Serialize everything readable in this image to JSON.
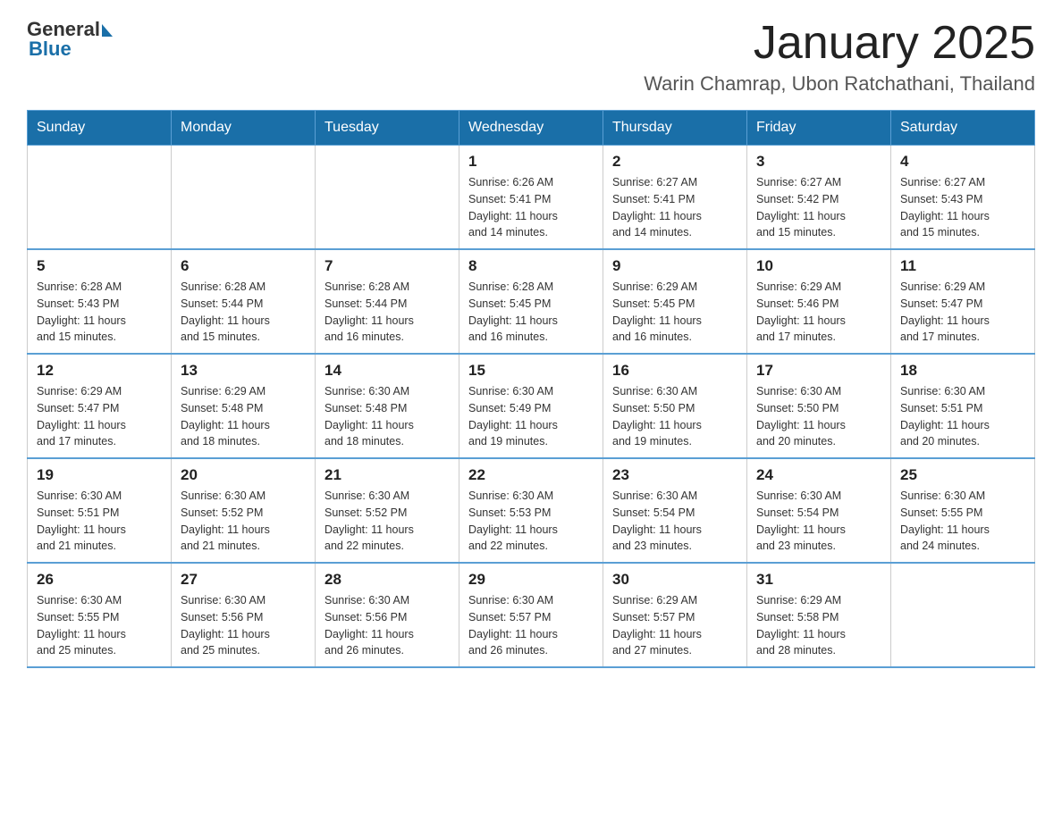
{
  "logo": {
    "line1": "General",
    "triangle": true,
    "line2": "Blue"
  },
  "title": "January 2025",
  "subtitle": "Warin Chamrap, Ubon Ratchathani, Thailand",
  "weekdays": [
    "Sunday",
    "Monday",
    "Tuesday",
    "Wednesday",
    "Thursday",
    "Friday",
    "Saturday"
  ],
  "weeks": [
    [
      {
        "day": "",
        "info": ""
      },
      {
        "day": "",
        "info": ""
      },
      {
        "day": "",
        "info": ""
      },
      {
        "day": "1",
        "info": "Sunrise: 6:26 AM\nSunset: 5:41 PM\nDaylight: 11 hours\nand 14 minutes."
      },
      {
        "day": "2",
        "info": "Sunrise: 6:27 AM\nSunset: 5:41 PM\nDaylight: 11 hours\nand 14 minutes."
      },
      {
        "day": "3",
        "info": "Sunrise: 6:27 AM\nSunset: 5:42 PM\nDaylight: 11 hours\nand 15 minutes."
      },
      {
        "day": "4",
        "info": "Sunrise: 6:27 AM\nSunset: 5:43 PM\nDaylight: 11 hours\nand 15 minutes."
      }
    ],
    [
      {
        "day": "5",
        "info": "Sunrise: 6:28 AM\nSunset: 5:43 PM\nDaylight: 11 hours\nand 15 minutes."
      },
      {
        "day": "6",
        "info": "Sunrise: 6:28 AM\nSunset: 5:44 PM\nDaylight: 11 hours\nand 15 minutes."
      },
      {
        "day": "7",
        "info": "Sunrise: 6:28 AM\nSunset: 5:44 PM\nDaylight: 11 hours\nand 16 minutes."
      },
      {
        "day": "8",
        "info": "Sunrise: 6:28 AM\nSunset: 5:45 PM\nDaylight: 11 hours\nand 16 minutes."
      },
      {
        "day": "9",
        "info": "Sunrise: 6:29 AM\nSunset: 5:45 PM\nDaylight: 11 hours\nand 16 minutes."
      },
      {
        "day": "10",
        "info": "Sunrise: 6:29 AM\nSunset: 5:46 PM\nDaylight: 11 hours\nand 17 minutes."
      },
      {
        "day": "11",
        "info": "Sunrise: 6:29 AM\nSunset: 5:47 PM\nDaylight: 11 hours\nand 17 minutes."
      }
    ],
    [
      {
        "day": "12",
        "info": "Sunrise: 6:29 AM\nSunset: 5:47 PM\nDaylight: 11 hours\nand 17 minutes."
      },
      {
        "day": "13",
        "info": "Sunrise: 6:29 AM\nSunset: 5:48 PM\nDaylight: 11 hours\nand 18 minutes."
      },
      {
        "day": "14",
        "info": "Sunrise: 6:30 AM\nSunset: 5:48 PM\nDaylight: 11 hours\nand 18 minutes."
      },
      {
        "day": "15",
        "info": "Sunrise: 6:30 AM\nSunset: 5:49 PM\nDaylight: 11 hours\nand 19 minutes."
      },
      {
        "day": "16",
        "info": "Sunrise: 6:30 AM\nSunset: 5:50 PM\nDaylight: 11 hours\nand 19 minutes."
      },
      {
        "day": "17",
        "info": "Sunrise: 6:30 AM\nSunset: 5:50 PM\nDaylight: 11 hours\nand 20 minutes."
      },
      {
        "day": "18",
        "info": "Sunrise: 6:30 AM\nSunset: 5:51 PM\nDaylight: 11 hours\nand 20 minutes."
      }
    ],
    [
      {
        "day": "19",
        "info": "Sunrise: 6:30 AM\nSunset: 5:51 PM\nDaylight: 11 hours\nand 21 minutes."
      },
      {
        "day": "20",
        "info": "Sunrise: 6:30 AM\nSunset: 5:52 PM\nDaylight: 11 hours\nand 21 minutes."
      },
      {
        "day": "21",
        "info": "Sunrise: 6:30 AM\nSunset: 5:52 PM\nDaylight: 11 hours\nand 22 minutes."
      },
      {
        "day": "22",
        "info": "Sunrise: 6:30 AM\nSunset: 5:53 PM\nDaylight: 11 hours\nand 22 minutes."
      },
      {
        "day": "23",
        "info": "Sunrise: 6:30 AM\nSunset: 5:54 PM\nDaylight: 11 hours\nand 23 minutes."
      },
      {
        "day": "24",
        "info": "Sunrise: 6:30 AM\nSunset: 5:54 PM\nDaylight: 11 hours\nand 23 minutes."
      },
      {
        "day": "25",
        "info": "Sunrise: 6:30 AM\nSunset: 5:55 PM\nDaylight: 11 hours\nand 24 minutes."
      }
    ],
    [
      {
        "day": "26",
        "info": "Sunrise: 6:30 AM\nSunset: 5:55 PM\nDaylight: 11 hours\nand 25 minutes."
      },
      {
        "day": "27",
        "info": "Sunrise: 6:30 AM\nSunset: 5:56 PM\nDaylight: 11 hours\nand 25 minutes."
      },
      {
        "day": "28",
        "info": "Sunrise: 6:30 AM\nSunset: 5:56 PM\nDaylight: 11 hours\nand 26 minutes."
      },
      {
        "day": "29",
        "info": "Sunrise: 6:30 AM\nSunset: 5:57 PM\nDaylight: 11 hours\nand 26 minutes."
      },
      {
        "day": "30",
        "info": "Sunrise: 6:29 AM\nSunset: 5:57 PM\nDaylight: 11 hours\nand 27 minutes."
      },
      {
        "day": "31",
        "info": "Sunrise: 6:29 AM\nSunset: 5:58 PM\nDaylight: 11 hours\nand 28 minutes."
      },
      {
        "day": "",
        "info": ""
      }
    ]
  ]
}
